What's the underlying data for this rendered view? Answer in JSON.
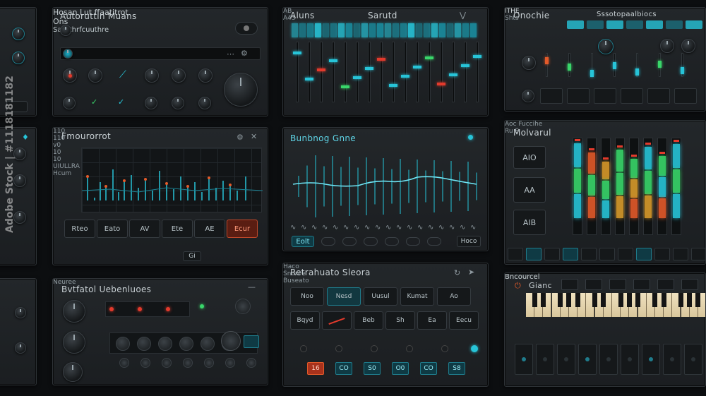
{
  "panels": {
    "p1": {
      "title": "Autoruttin Muans",
      "line1": "Hosan Lut ffaatitrot",
      "line2": "Ons",
      "status": "Satnthrfcuuthre"
    },
    "p2": {
      "title": "Aluns",
      "subtitle": "Sarutd",
      "footer_left": "AB",
      "footer_mid": "A43"
    },
    "p3": {
      "title": "Onochie",
      "subtitle": "Sssotopaalbiocs",
      "small_label": "Shts",
      "top_tag": "ITHE"
    },
    "p4": {
      "title": "Fmourorrot",
      "yticks": [
        "110",
        "110",
        "v0",
        "10",
        "10"
      ],
      "buttons": [
        "Rteo",
        "Eato",
        "AV",
        "Ete",
        "AE",
        "Ecur"
      ],
      "footer_left": "UIULLRA",
      "footer_mid": "Gi",
      "footer_right": "Hcum"
    },
    "p5": {
      "title": "Bunbnog Gnne",
      "btn_left": "Eolt",
      "btn_right": "Hoco"
    },
    "p6": {
      "title": "Molvarul",
      "subtitle": "Aoc Fuccihe",
      "subtitle2": "Ru S",
      "side_buttons": [
        "AIO",
        "AA",
        "AIB"
      ]
    },
    "p7": {
      "title": "Bvtfatol Uebenluoes",
      "footer": "Neuree"
    },
    "p8": {
      "title": "Retrahuato Sleora",
      "row1": [
        "Noo",
        "Nesd",
        "Uusul",
        "Kumat",
        "Ao"
      ],
      "row2": [
        "Bqyd",
        "",
        "Beb",
        "Sh",
        "Ea",
        "Eecu"
      ],
      "labels": [
        "Haco",
        "Snonre",
        "Buseato"
      ],
      "bottom_buttons": [
        "16",
        "CO",
        "S0",
        "O0",
        "CO",
        "S8"
      ]
    },
    "p9": {
      "title": "Gianc",
      "subtitle": "Bncourcel"
    }
  },
  "watermark": "Adobe Stock | #1118181182",
  "colors": {
    "cyan": "#27c4d8",
    "orange": "#e35a2a",
    "green": "#39d66a",
    "red": "#e23a2c",
    "amber": "#d79a2b"
  }
}
